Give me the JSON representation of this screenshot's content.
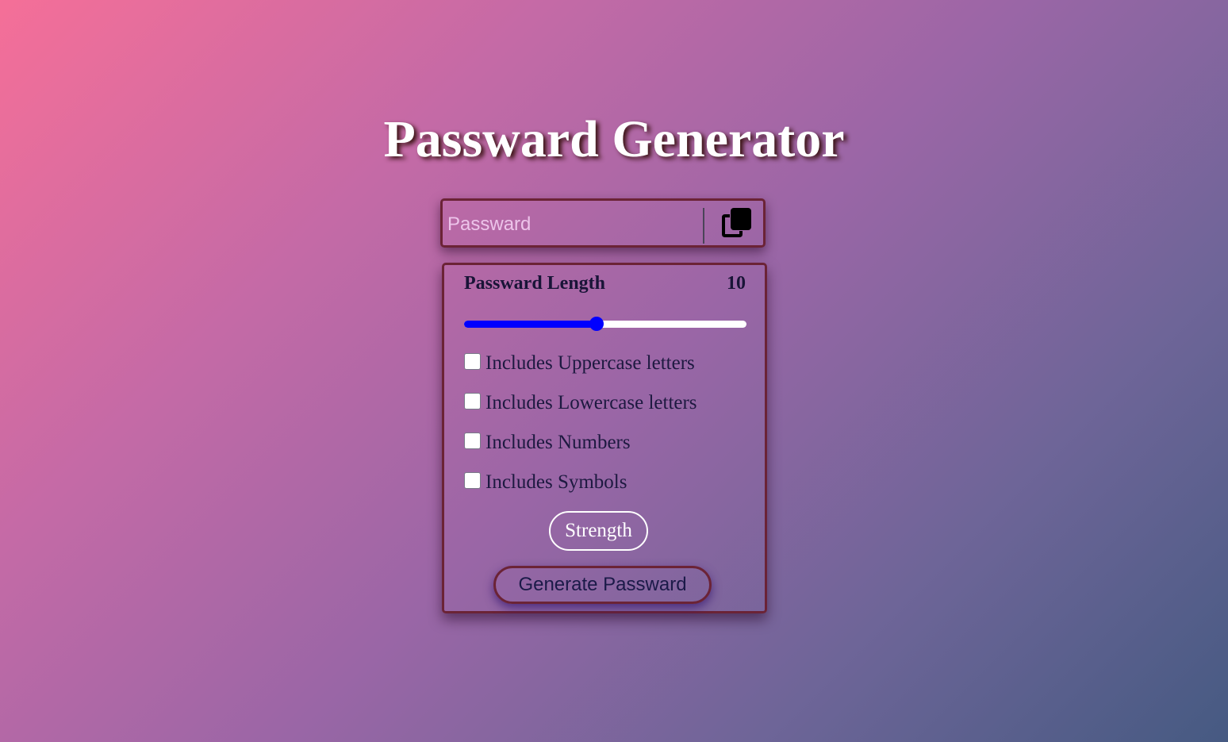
{
  "app": {
    "title": "Passward Generator"
  },
  "password_field": {
    "placeholder": "Passward",
    "value": "",
    "copy_icon": "copy-icon"
  },
  "length": {
    "label": "Passward Length",
    "value": "10",
    "slider_fraction": 0.47
  },
  "options": [
    {
      "label": "Includes Uppercase letters",
      "checked": false
    },
    {
      "label": "Includes Lowercase letters",
      "checked": false
    },
    {
      "label": "Includes Numbers",
      "checked": false
    },
    {
      "label": "Includes Symbols",
      "checked": false
    }
  ],
  "strength": {
    "label": "Strength"
  },
  "generate_button": {
    "label": "Generate Passward"
  },
  "colors": {
    "slider_accent": "#0000ff",
    "border": "#6b2336",
    "text_dark": "#191437"
  }
}
